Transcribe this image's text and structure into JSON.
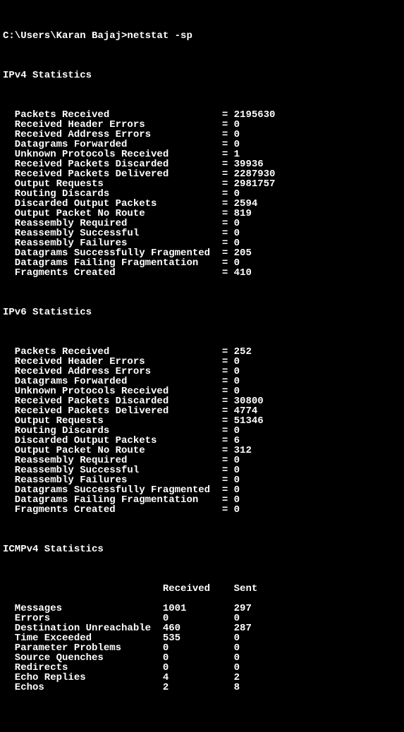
{
  "prompt": "C:\\Users\\Karan Bajaj>netstat -sp",
  "sections": {
    "ipv4": {
      "title": "IPv4 Statistics",
      "rows": [
        {
          "label": "Packets Received",
          "value": "2195630"
        },
        {
          "label": "Received Header Errors",
          "value": "0"
        },
        {
          "label": "Received Address Errors",
          "value": "0"
        },
        {
          "label": "Datagrams Forwarded",
          "value": "0"
        },
        {
          "label": "Unknown Protocols Received",
          "value": "1"
        },
        {
          "label": "Received Packets Discarded",
          "value": "39936"
        },
        {
          "label": "Received Packets Delivered",
          "value": "2287930"
        },
        {
          "label": "Output Requests",
          "value": "2981757"
        },
        {
          "label": "Routing Discards",
          "value": "0"
        },
        {
          "label": "Discarded Output Packets",
          "value": "2594"
        },
        {
          "label": "Output Packet No Route",
          "value": "819"
        },
        {
          "label": "Reassembly Required",
          "value": "0"
        },
        {
          "label": "Reassembly Successful",
          "value": "0"
        },
        {
          "label": "Reassembly Failures",
          "value": "0"
        },
        {
          "label": "Datagrams Successfully Fragmented",
          "value": "205"
        },
        {
          "label": "Datagrams Failing Fragmentation",
          "value": "0"
        },
        {
          "label": "Fragments Created",
          "value": "410"
        }
      ]
    },
    "ipv6": {
      "title": "IPv6 Statistics",
      "rows": [
        {
          "label": "Packets Received",
          "value": "252"
        },
        {
          "label": "Received Header Errors",
          "value": "0"
        },
        {
          "label": "Received Address Errors",
          "value": "0"
        },
        {
          "label": "Datagrams Forwarded",
          "value": "0"
        },
        {
          "label": "Unknown Protocols Received",
          "value": "0"
        },
        {
          "label": "Received Packets Discarded",
          "value": "30800"
        },
        {
          "label": "Received Packets Delivered",
          "value": "4774"
        },
        {
          "label": "Output Requests",
          "value": "51346"
        },
        {
          "label": "Routing Discards",
          "value": "0"
        },
        {
          "label": "Discarded Output Packets",
          "value": "6"
        },
        {
          "label": "Output Packet No Route",
          "value": "312"
        },
        {
          "label": "Reassembly Required",
          "value": "0"
        },
        {
          "label": "Reassembly Successful",
          "value": "0"
        },
        {
          "label": "Reassembly Failures",
          "value": "0"
        },
        {
          "label": "Datagrams Successfully Fragmented",
          "value": "0"
        },
        {
          "label": "Datagrams Failing Fragmentation",
          "value": "0"
        },
        {
          "label": "Fragments Created",
          "value": "0"
        }
      ]
    },
    "icmpv4": {
      "title": "ICMPv4 Statistics",
      "headers": {
        "c1": "Received",
        "c2": "Sent"
      },
      "rows": [
        {
          "label": "Messages",
          "c1": "1001",
          "c2": "297"
        },
        {
          "label": "Errors",
          "c1": "0",
          "c2": "0"
        },
        {
          "label": "Destination Unreachable",
          "c1": "460",
          "c2": "287"
        },
        {
          "label": "Time Exceeded",
          "c1": "535",
          "c2": "0"
        },
        {
          "label": "Parameter Problems",
          "c1": "0",
          "c2": "0"
        },
        {
          "label": "Source Quenches",
          "c1": "0",
          "c2": "0"
        },
        {
          "label": "Redirects",
          "c1": "0",
          "c2": "0"
        },
        {
          "label": "Echo Replies",
          "c1": "4",
          "c2": "2"
        },
        {
          "label": "Echos",
          "c1": "2",
          "c2": "8"
        }
      ]
    }
  }
}
